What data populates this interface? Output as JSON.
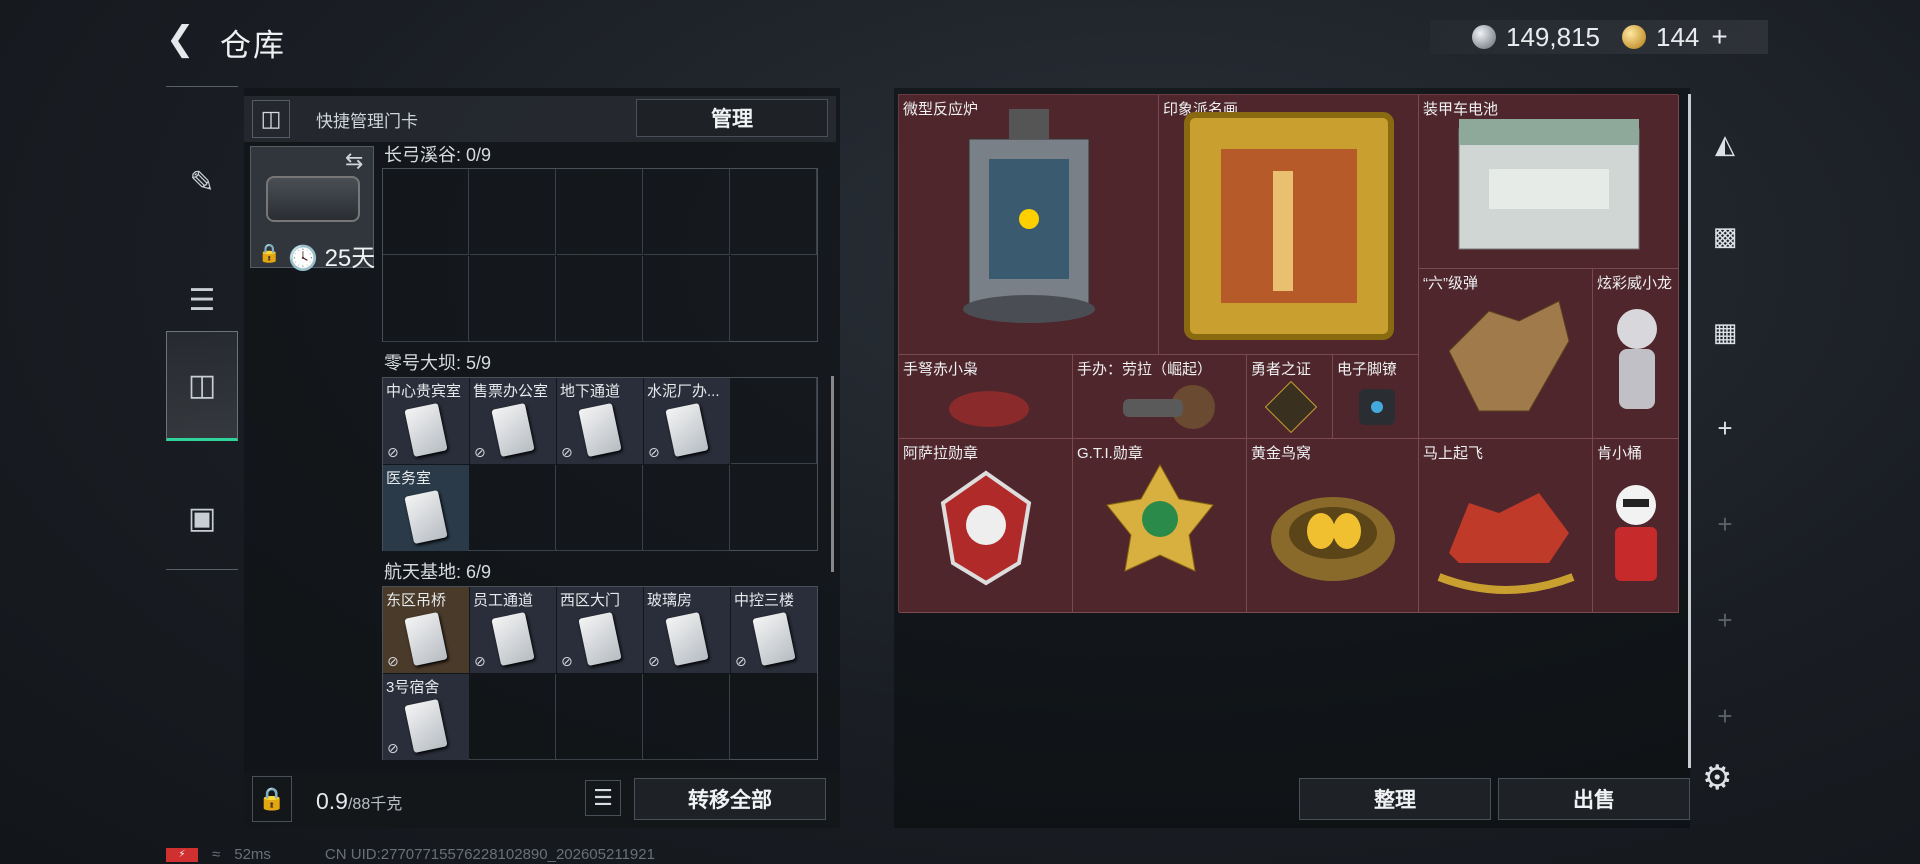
{
  "header": {
    "back_icon": "back-arrow-icon",
    "title": "仓库",
    "currency_silver": "149,815",
    "currency_gold": "144",
    "gold_plus": "+"
  },
  "left_nav": {
    "items": [
      {
        "name": "weapons",
        "icon": "gun-icon"
      },
      {
        "name": "equipment",
        "icon": "backpack-icon"
      },
      {
        "name": "keycards",
        "icon": "keycard-icon",
        "active": true
      },
      {
        "name": "toolbox",
        "icon": "briefcase-icon"
      }
    ]
  },
  "quick_manage": {
    "label": "快捷管理门卡",
    "button": "管理"
  },
  "keycard_slot": {
    "days": "25天"
  },
  "sections": [
    {
      "title": "长弓溪谷: 0/9",
      "cards": []
    },
    {
      "title": "零号大坝: 5/9",
      "cards": [
        "中心贵宾室",
        "售票办公室",
        "地下通道",
        "水泥厂办...",
        "医务室"
      ]
    },
    {
      "title": "航天基地: 6/9",
      "cards": [
        "东区吊桥",
        "员工通道",
        "西区大门",
        "玻璃房",
        "中控三楼",
        "3号宿舍"
      ]
    }
  ],
  "weight": {
    "value": "0.9",
    "max": "/88千克"
  },
  "buttons": {
    "transfer_all": "转移全部",
    "sort": "整理",
    "sell": "出售"
  },
  "items": [
    {
      "name": "微型反应炉"
    },
    {
      "name": "印象派名画"
    },
    {
      "name": "装甲车电池"
    },
    {
      "name": "“六”级弹"
    },
    {
      "name": "炫彩威小龙"
    },
    {
      "name": "手弩赤小枭"
    },
    {
      "name": "手办：劳拉（崛起）"
    },
    {
      "name": "勇者之证"
    },
    {
      "name": "电子脚镣"
    },
    {
      "name": "阿萨拉勋章"
    },
    {
      "name": "G.T.I.勋章"
    },
    {
      "name": "黄金鸟窝"
    },
    {
      "name": "马上起飞"
    },
    {
      "name": "肯小桶"
    }
  ],
  "status": {
    "ping": "52ms",
    "uid": "CN UID:27707715576228102890_202605211921"
  }
}
